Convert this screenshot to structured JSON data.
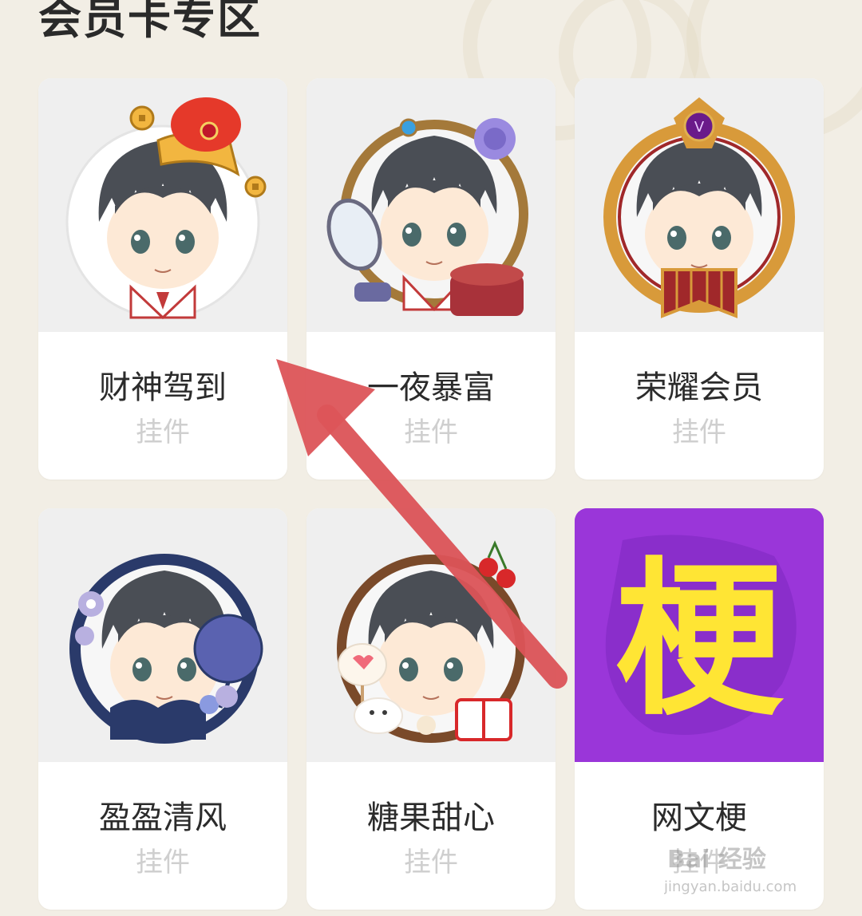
{
  "section": {
    "title": "会员卡专区"
  },
  "cards": [
    {
      "name": "财神驾到",
      "type": "挂件",
      "icon": "avatar-frame-god-of-wealth-icon",
      "frame_color": "#e03a2a"
    },
    {
      "name": "一夜暴富",
      "type": "挂件",
      "icon": "avatar-frame-overnight-rich-icon",
      "frame_color": "#a4793a"
    },
    {
      "name": "荣耀会员",
      "type": "挂件",
      "icon": "avatar-frame-honor-member-icon",
      "frame_color": "#d89a3a"
    },
    {
      "name": "盈盈清风",
      "type": "挂件",
      "icon": "avatar-frame-gentle-breeze-icon",
      "frame_color": "#2a3a6a"
    },
    {
      "name": "糖果甜心",
      "type": "挂件",
      "icon": "avatar-frame-candy-sweetheart-icon",
      "frame_color": "#7a4a2a"
    },
    {
      "name": "网文梗",
      "type": "挂件",
      "icon": "avatar-frame-web-novel-meme-icon",
      "frame_color": "#9a36d9",
      "badge_char": "梗"
    }
  ],
  "annotation": {
    "arrow_color": "#dc5458"
  },
  "watermark": {
    "logo": "Bai 经验",
    "url": "jingyan.baidu.com"
  }
}
